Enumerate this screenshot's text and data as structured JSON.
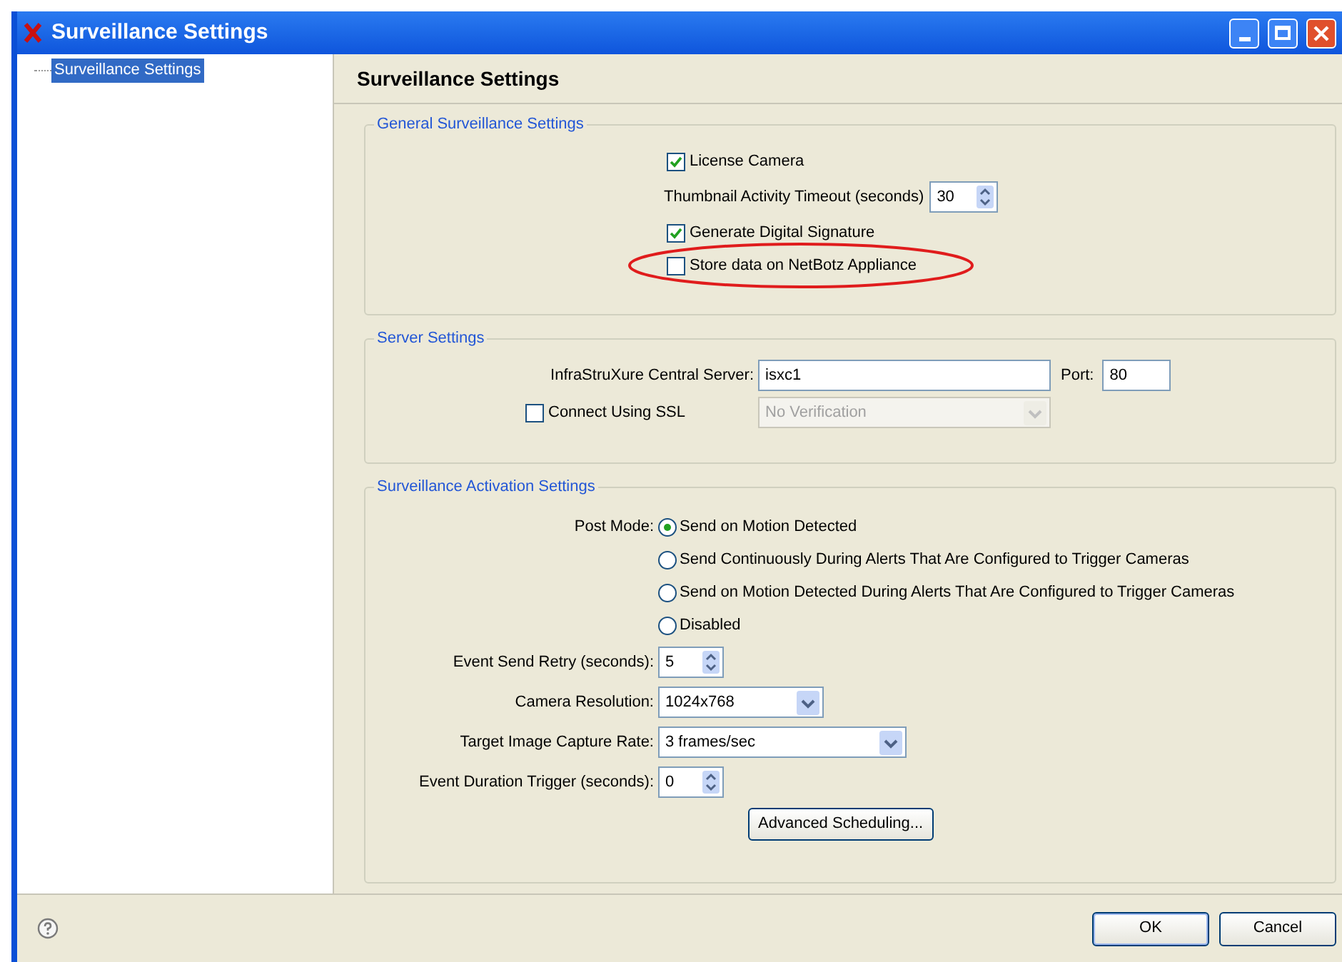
{
  "window": {
    "title": "Surveillance Settings"
  },
  "tree": [
    {
      "label": "Surveillance Settings",
      "selected": true
    }
  ],
  "page_title": "Surveillance Settings",
  "general": {
    "title": "General Surveillance Settings",
    "items": [
      {
        "kind": "checkbox",
        "label": "License Camera",
        "checked": true,
        "circled": false
      },
      {
        "kind": "spinner",
        "label": "Thumbnail Activity Timeout (seconds)",
        "value": "30"
      },
      {
        "kind": "checkbox",
        "label": "Generate Digital Signature",
        "checked": true,
        "circled": false
      },
      {
        "kind": "checkbox",
        "label": "Store data on NetBotz Appliance",
        "checked": false,
        "circled": true
      }
    ]
  },
  "server": {
    "title": "Server Settings",
    "server_label": "InfraStruXure Central Server:",
    "server_value": "isxc1",
    "port_label": "Port:",
    "port_value": "80",
    "ssl": {
      "label": "Connect Using SSL",
      "checked": false
    },
    "verification": {
      "value": "No Verification",
      "disabled": true
    }
  },
  "activation": {
    "title": "Surveillance Activation Settings",
    "post_mode_label": "Post Mode:",
    "options": [
      {
        "label": "Send on Motion Detected",
        "selected": true
      },
      {
        "label": "Send Continuously During Alerts That Are Configured to Trigger Cameras",
        "selected": false
      },
      {
        "label": "Send on Motion Detected During Alerts That Are Configured to Trigger Cameras",
        "selected": false
      },
      {
        "label": "Disabled",
        "selected": false
      }
    ],
    "fields": [
      {
        "kind": "spinner",
        "label": "Event Send Retry (seconds):",
        "value": "5"
      },
      {
        "kind": "dropdown",
        "label": "Camera Resolution:",
        "value": "1024x768"
      },
      {
        "kind": "dropdown",
        "label": "Target Image Capture Rate:",
        "value": "3 frames/sec"
      },
      {
        "kind": "spinner",
        "label": "Event Duration Trigger (seconds):",
        "value": "0"
      }
    ],
    "advanced_button": "Advanced Scheduling..."
  },
  "footer": {
    "buttons": [
      "OK",
      "Cancel"
    ]
  }
}
